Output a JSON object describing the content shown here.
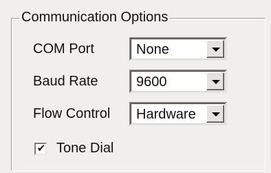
{
  "group": {
    "title": "Communication Options"
  },
  "com_port": {
    "label": "COM Port",
    "value": "None"
  },
  "baud_rate": {
    "label": "Baud Rate",
    "value": "9600"
  },
  "flow_control": {
    "label": "Flow Control",
    "value": "Hardware"
  },
  "tone_dial": {
    "label": "Tone Dial",
    "checked": true,
    "check_glyph": "✔"
  },
  "icons": {
    "dropdown": "chevron-down-icon",
    "check": "checkmark-icon"
  }
}
